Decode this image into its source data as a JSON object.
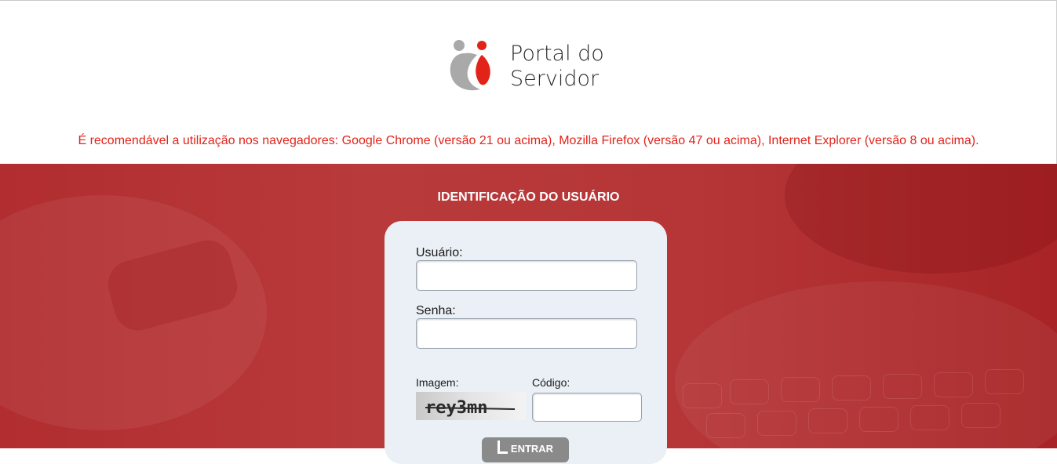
{
  "logo": {
    "line1": "Portal do",
    "line2": "Servidor"
  },
  "notice": "É recomendável a utilização nos navegadores: Google Chrome (versão 21 ou acima), Mozilla Firefox (versão 47 ou acima), Internet Explorer (versão 8 ou acima).",
  "login": {
    "title": "IDENTIFICAÇÃO DO USUÁRIO",
    "usuario_label": "Usuário:",
    "usuario_value": "",
    "senha_label": "Senha:",
    "senha_value": "",
    "imagem_label": "Imagem:",
    "codigo_label": "Código:",
    "codigo_value": "",
    "captcha_text": "rey3mn",
    "submit_label": "ENTRAR"
  },
  "colors": {
    "brand_red": "#e2231a",
    "hero_red": "#b12d2f",
    "card_bg": "#eaf0f6",
    "logo_gray": "#a9a9a9"
  }
}
